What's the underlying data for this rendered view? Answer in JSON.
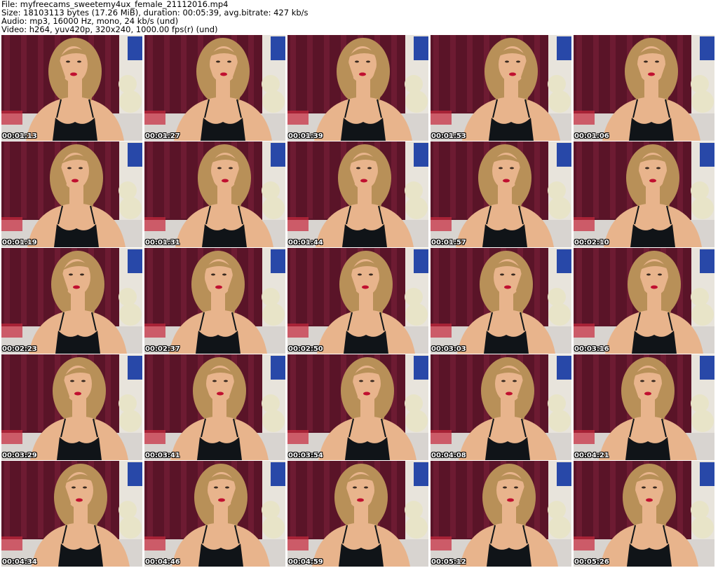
{
  "header": {
    "file": "File: myfreecams_sweetemy4ux_female_21112016.mp4",
    "size": "Size: 18103113 bytes (17.26 MiB), duration: 00:05:39, avg.bitrate: 427 kb/s",
    "audio": "Audio: mp3, 16000 Hz, mono, 24 kb/s (und)",
    "video": "Video: h264, yuv420p, 320x240, 1000.00 fps(r) (und)"
  },
  "thumbnails": [
    {
      "timestamp": "00:01:13"
    },
    {
      "timestamp": "00:01:27"
    },
    {
      "timestamp": "00:01:39"
    },
    {
      "timestamp": "00:01:53"
    },
    {
      "timestamp": "00:01:06"
    },
    {
      "timestamp": "00:01:19"
    },
    {
      "timestamp": "00:01:31"
    },
    {
      "timestamp": "00:01:44"
    },
    {
      "timestamp": "00:01:57"
    },
    {
      "timestamp": "00:02:10"
    },
    {
      "timestamp": "00:02:23"
    },
    {
      "timestamp": "00:02:37"
    },
    {
      "timestamp": "00:02:50"
    },
    {
      "timestamp": "00:03:03"
    },
    {
      "timestamp": "00:03:16"
    },
    {
      "timestamp": "00:03:29"
    },
    {
      "timestamp": "00:03:41"
    },
    {
      "timestamp": "00:03:54"
    },
    {
      "timestamp": "00:04:08"
    },
    {
      "timestamp": "00:04:21"
    },
    {
      "timestamp": "00:04:34"
    },
    {
      "timestamp": "00:04:46"
    },
    {
      "timestamp": "00:04:59"
    },
    {
      "timestamp": "00:05:12"
    },
    {
      "timestamp": "00:05:26"
    }
  ],
  "colors": {
    "curtain": "#5a1428",
    "curtain_fold": "#7a2038",
    "wall": "#e8e4dc",
    "skin": "#e8b48c",
    "hair": "#b89058",
    "top": "#101418",
    "lips": "#c01030",
    "bed": "#d8d4d0",
    "plush": "#e8e4c8",
    "screen": "#2848a8"
  }
}
